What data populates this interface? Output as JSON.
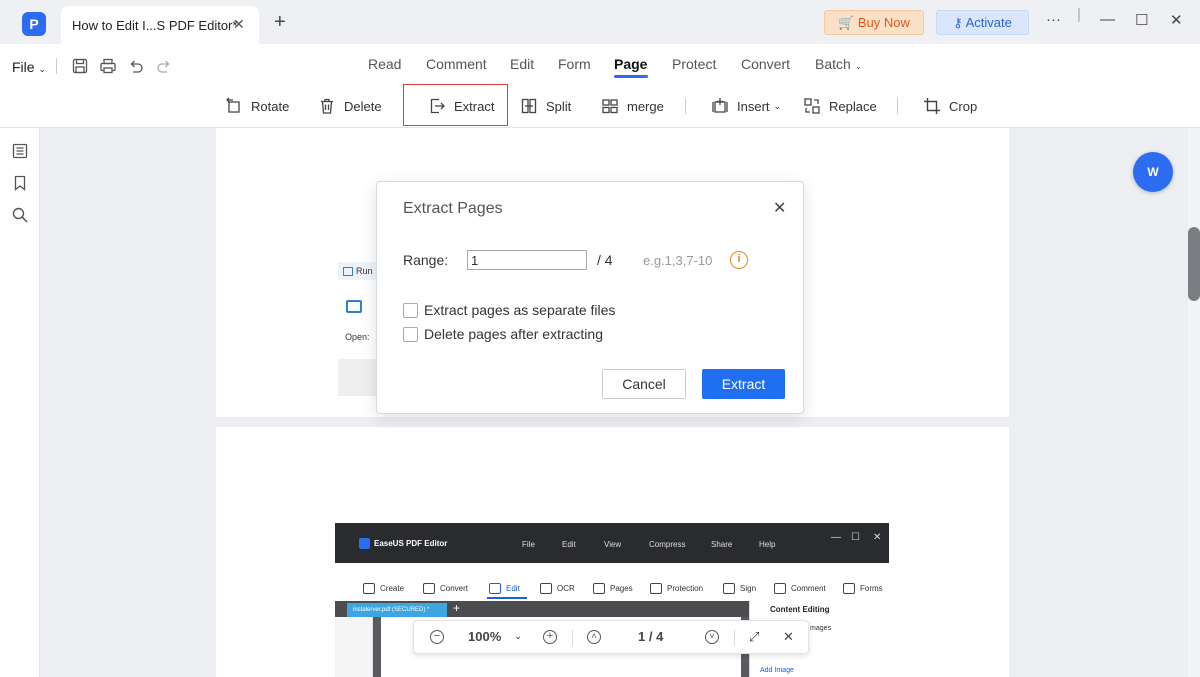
{
  "titlebar": {
    "tab_title": "How to Edit I...S PDF Editor*",
    "tab_close": "✕",
    "new_tab": "+",
    "buy_now": "Buy Now",
    "activate": "Activate",
    "more": "···",
    "minimize": "—",
    "maximize": "☐",
    "close": "✕"
  },
  "menu": {
    "file": "File",
    "tabs": [
      "Read",
      "Comment",
      "Edit",
      "Form",
      "Page",
      "Protect",
      "Convert",
      "Batch"
    ],
    "active_tab": "Page"
  },
  "toolbar": {
    "rotate": "Rotate",
    "delete": "Delete",
    "extract": "Extract",
    "split": "Split",
    "merge": "merge",
    "insert": "Insert",
    "replace": "Replace",
    "crop": "Crop"
  },
  "page1_snippet": {
    "run": "Run",
    "open": "Open:"
  },
  "embedded": {
    "app_name": "EaseUS PDF Editor",
    "menu": [
      "File",
      "Edit",
      "View",
      "Compress",
      "Share",
      "Help"
    ],
    "tools": [
      "Create",
      "Convert",
      "Edit",
      "OCR",
      "Pages",
      "Protection",
      "Sign",
      "Comment",
      "Forms"
    ],
    "tab": "instalerver.pdf (SECURED) *",
    "content_editing": "Content Editing",
    "images": "mages",
    "add_image": "Add Image"
  },
  "zoombar": {
    "zoom": "100%",
    "page": "1 / 4"
  },
  "dialog": {
    "title": "Extract Pages",
    "range_label": "Range:",
    "range_value": "1",
    "range_total": "/ 4",
    "range_example": "e.g.1,3,7-10",
    "option_separate": "Extract pages as separate files",
    "option_delete": "Delete pages after extracting",
    "cancel": "Cancel",
    "extract": "Extract"
  },
  "colors": {
    "accent": "#1f6ff0",
    "highlight": "#d9403b",
    "buy_now": "#e05a1a"
  }
}
